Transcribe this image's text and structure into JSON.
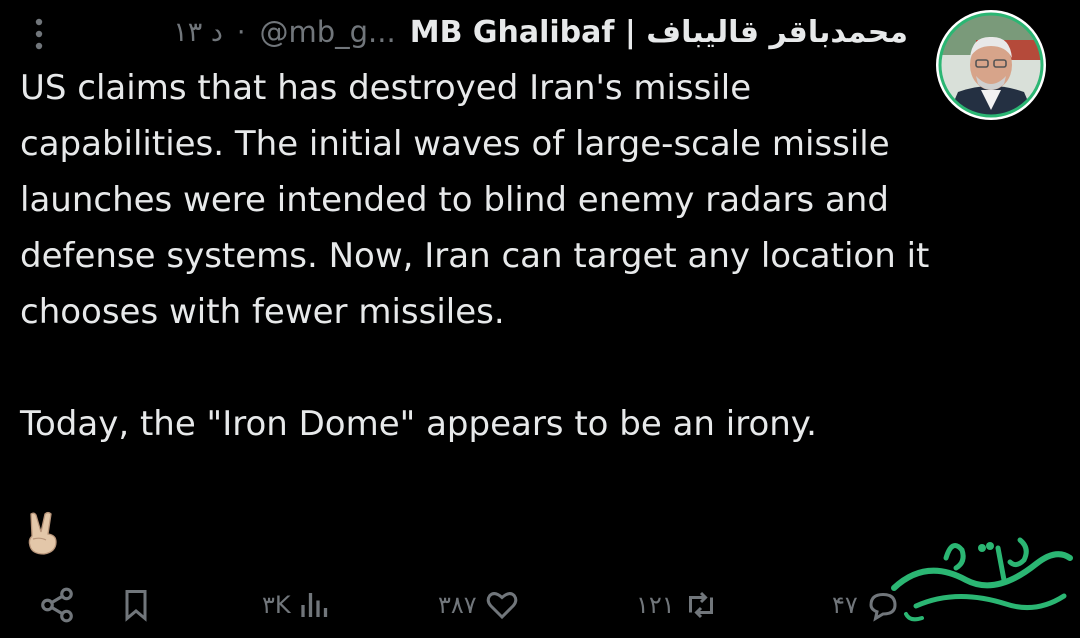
{
  "header": {
    "display_name": "MB Ghalibaf | محمدباقر قالیباف",
    "handle": "@mb_g...",
    "separator": "·",
    "time": "۱۳ د"
  },
  "tweet": {
    "text": "US claims that has destroyed Iran's missile capabilities. The initial waves of large-scale missile launches were intended to blind enemy radars and defense systems. Now, Iran can target any location it chooses with fewer missiles.\n\nToday, the \"Iron Dome\" appears to be an irony.",
    "emoji": "victory-hand"
  },
  "actions": {
    "replies": "۴۷",
    "reposts": "۱۲۱",
    "likes": "۳۸۷",
    "views": "۳K"
  },
  "colors": {
    "background": "#000000",
    "text": "#e7e9ea",
    "muted": "#71767b",
    "watermark": "#2bb673"
  },
  "icons": [
    "more-vertical-icon",
    "reply-icon",
    "repost-icon",
    "like-icon",
    "views-icon",
    "bookmark-icon",
    "share-icon",
    "avatar-photo"
  ]
}
